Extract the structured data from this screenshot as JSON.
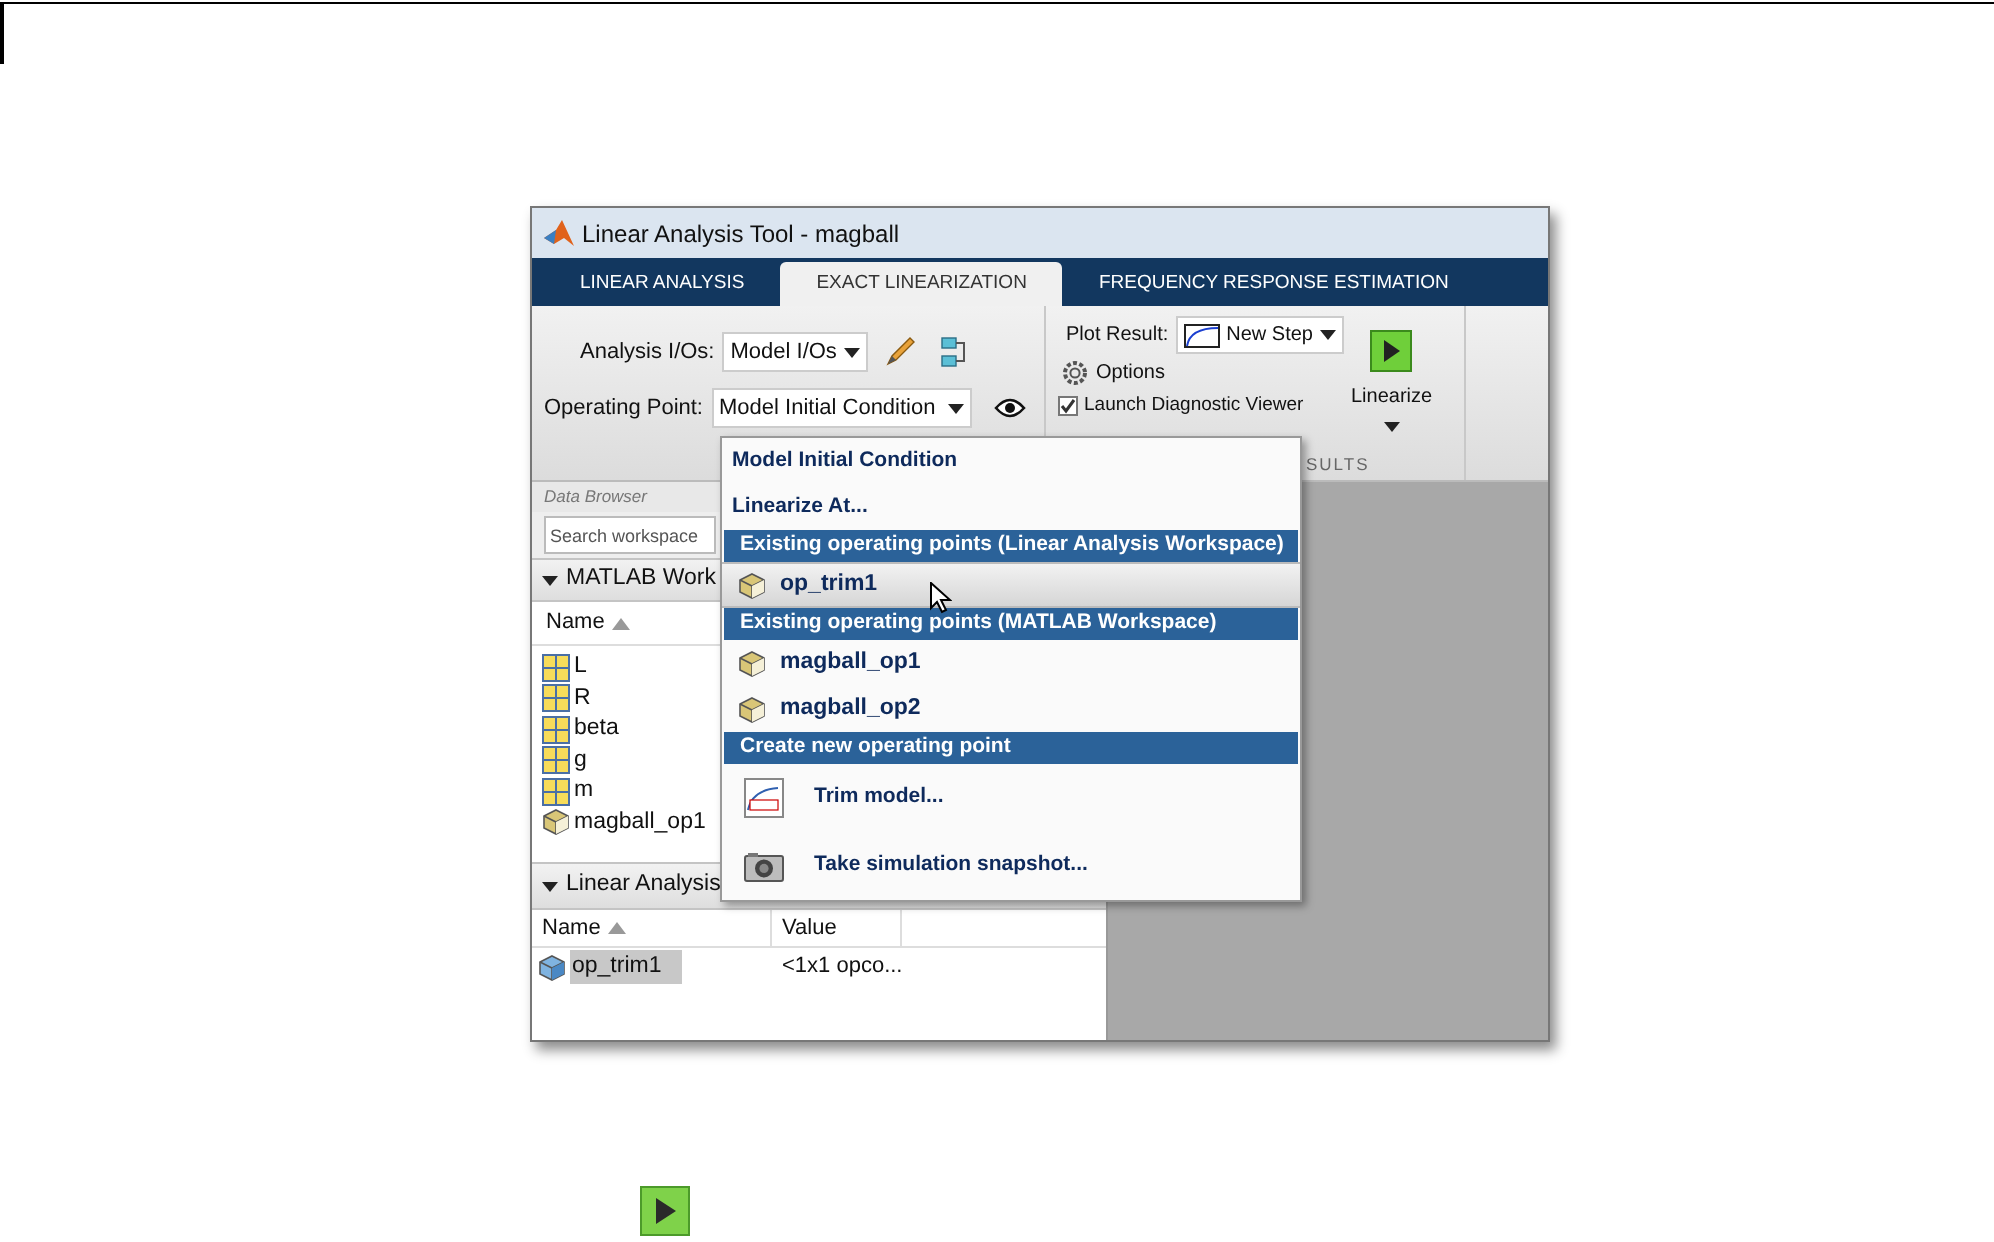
{
  "window": {
    "title": "Linear Analysis Tool - magball"
  },
  "tabs": [
    {
      "label": "LINEAR ANALYSIS",
      "selected": false
    },
    {
      "label": "EXACT LINEARIZATION",
      "selected": true
    },
    {
      "label": "FREQUENCY RESPONSE ESTIMATION",
      "selected": false
    }
  ],
  "toolstrip": {
    "analysis_ios": {
      "label": "Analysis I/Os:",
      "value": "Model I/Os"
    },
    "operating_point": {
      "label": "Operating Point:",
      "value": "Model Initial Condition"
    },
    "plot_result": {
      "label": "Plot Result:",
      "value": "New Step"
    },
    "options": "Options",
    "launch_diagnostic_viewer": {
      "label": "Launch Diagnostic Viewer",
      "checked": true
    },
    "linearize": "Linearize",
    "section_label": "SULTS"
  },
  "data_browser": {
    "title": "Data Browser",
    "search": {
      "placeholder": "Search workspace"
    },
    "matlab_workspace": {
      "title": "MATLAB Work",
      "column": "Name",
      "variables": [
        {
          "name": "L",
          "kind": "matrix"
        },
        {
          "name": "R",
          "kind": "matrix"
        },
        {
          "name": "beta",
          "kind": "matrix"
        },
        {
          "name": "g",
          "kind": "matrix"
        },
        {
          "name": "m",
          "kind": "matrix"
        },
        {
          "name": "magball_op1",
          "kind": "op"
        }
      ]
    },
    "linear_analysis_workspace": {
      "title": "Linear Analysis",
      "columns": [
        "Name",
        "Value"
      ],
      "rows": [
        {
          "name": "op_trim1",
          "value": "<1x1 opco...",
          "selected": true
        }
      ]
    }
  },
  "operating_point_menu": [
    {
      "kind": "option",
      "label": "Model Initial Condition",
      "selected": false
    },
    {
      "kind": "option",
      "label": "Linearize At...",
      "selected": false
    },
    {
      "kind": "header",
      "label": "Existing operating points (Linear Analysis Workspace)",
      "selected": false
    },
    {
      "kind": "op",
      "label": "op_trim1",
      "selected": true
    },
    {
      "kind": "header",
      "label": "Existing operating points (MATLAB Workspace)",
      "selected": false
    },
    {
      "kind": "op",
      "label": "magball_op1",
      "selected": false
    },
    {
      "kind": "op",
      "label": "magball_op2",
      "selected": false
    },
    {
      "kind": "header",
      "label": "Create new operating point",
      "selected": false
    },
    {
      "kind": "trim",
      "label": "Trim model...",
      "selected": false
    },
    {
      "kind": "snapshot",
      "label": "Take simulation snapshot...",
      "selected": false
    }
  ]
}
